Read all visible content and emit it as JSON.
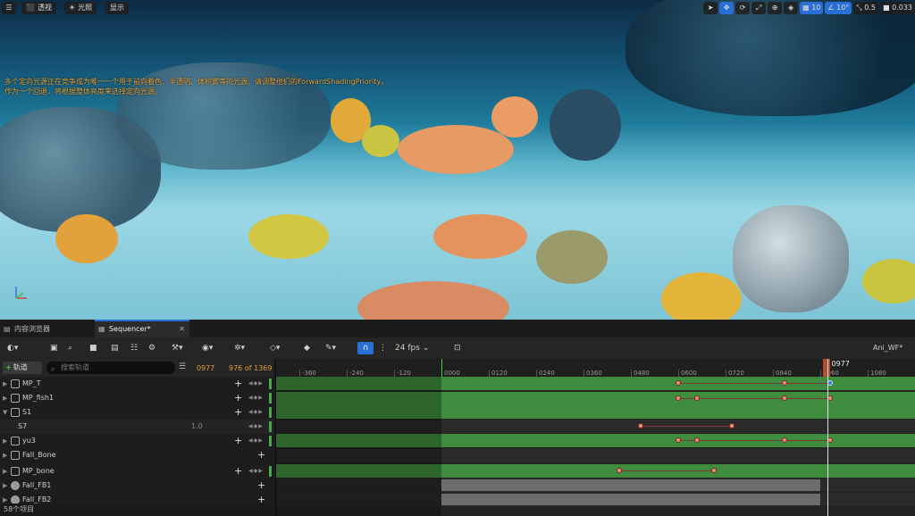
{
  "viewport": {
    "top_left_buttons": [
      {
        "icon": "cube-icon",
        "label": "透视"
      },
      {
        "icon": "sun-icon",
        "label": "光照"
      },
      {
        "label": "显示"
      }
    ],
    "top_right_tools": [
      {
        "icon": "select-arrow-icon",
        "active": false
      },
      {
        "icon": "move-icon",
        "active": true
      },
      {
        "icon": "rotate-icon",
        "active": false
      },
      {
        "icon": "scale-icon",
        "active": false
      },
      {
        "icon": "globe-icon",
        "active": false
      },
      {
        "icon": "surface-snap-icon",
        "active": false
      },
      {
        "icon": "grid-snap-icon",
        "label": "10",
        "active": true
      },
      {
        "icon": "angle-snap-icon",
        "label": "10°",
        "active": true
      },
      {
        "icon": "scale-snap-icon",
        "label": "0.5",
        "active": false
      },
      {
        "icon": "camera-speed-icon",
        "label": "0.033",
        "active": false
      }
    ],
    "warning_lines": [
      "多个定向光源正在竞争成为唯一一个用于前向着色、半透明、体积雾等的光源。请调整他们的ForwardShadingPriority。",
      "作为一个回退，将根据整体亮度来选择定向光源。"
    ]
  },
  "tabs": [
    {
      "label": "内容浏览器",
      "icon": "content-browser-icon",
      "active": false
    },
    {
      "label": "Sequencer*",
      "icon": "sequencer-icon",
      "active": true
    }
  ],
  "toolbar": {
    "fps": "24 fps",
    "sequence_name": "Ani_WF*"
  },
  "outliner": {
    "add_track_label": "轨道",
    "search_placeholder": "搜索轨道",
    "current_frame": "0977",
    "frame_of_total": "976 of 1369",
    "footer": "58个项目",
    "rows": [
      {
        "name": "MP_T",
        "icon": "actor-icon",
        "expand": "▶",
        "has_plus": true,
        "has_keys": true
      },
      {
        "name": "MP_fish1",
        "icon": "actor-icon",
        "expand": "▶",
        "has_plus": true,
        "has_keys": true
      },
      {
        "name": "S1",
        "icon": "actor-icon",
        "expand": "▼",
        "has_plus": true,
        "has_keys": true
      },
      {
        "name": "S7",
        "icon": "",
        "expand": "",
        "has_plus": false,
        "has_keys": true,
        "value": "1.0"
      },
      {
        "name": "yu3",
        "icon": "actor-icon",
        "expand": "▶",
        "has_plus": true,
        "has_keys": true
      },
      {
        "name": "Fall_Bone",
        "icon": "skeleton-icon",
        "expand": "▶",
        "has_plus": true,
        "has_keys": false
      },
      {
        "name": "MP_bone",
        "icon": "actor-icon",
        "expand": "▶",
        "has_plus": true,
        "has_keys": true
      },
      {
        "name": "Fall_FB1",
        "icon": "sphere-icon",
        "expand": "▶",
        "has_plus": true,
        "has_keys": false
      },
      {
        "name": "Fall_FB2",
        "icon": "sphere-icon",
        "expand": "▶",
        "has_plus": true,
        "has_keys": false
      }
    ]
  },
  "timeline": {
    "ticks": [
      "-360",
      "-240",
      "-120",
      "0000",
      "0120",
      "0240",
      "0360",
      "0480",
      "0600",
      "0720",
      "0840",
      "0960",
      "1080"
    ],
    "playhead_label": "0977",
    "playhead_frame": 977,
    "lanes": [
      {
        "kind": "green",
        "keys": [
          600,
          870,
          985
        ],
        "line": [
          600,
          985
        ],
        "selected_last": true
      },
      {
        "kind": "green",
        "keys": [
          600,
          648,
          870,
          985
        ],
        "line": [
          600,
          985
        ]
      },
      {
        "kind": "green",
        "keys": [],
        "line": null
      },
      {
        "kind": "dark",
        "keys": [
          505,
          735
        ],
        "line": [
          505,
          735
        ]
      },
      {
        "kind": "green",
        "keys": [
          600,
          648,
          870,
          985
        ],
        "line": [
          600,
          985
        ]
      },
      {
        "kind": "dark",
        "keys": [],
        "line": null
      },
      {
        "kind": "green",
        "keys": [
          450,
          690
        ],
        "line": [
          450,
          690
        ]
      },
      {
        "kind": "gray",
        "keys": [],
        "line": null,
        "start": 0,
        "end": 960
      },
      {
        "kind": "gray",
        "keys": [],
        "line": null,
        "start": 0,
        "end": 960
      }
    ]
  }
}
